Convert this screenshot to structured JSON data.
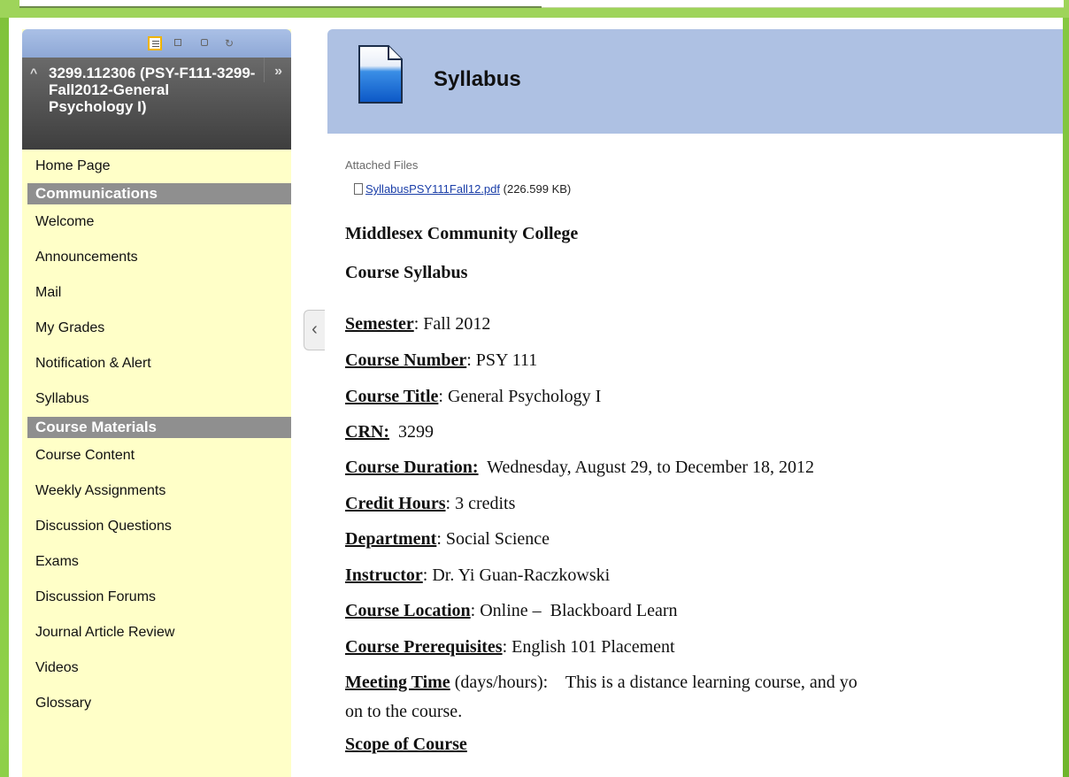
{
  "sidebar": {
    "course_title": "3299.112306 (PSY-F111-3299-Fall2012-General Psychology I)",
    "home": "Home Page",
    "sections": [
      {
        "title": "Communications",
        "items": [
          "Welcome",
          "Announcements",
          "Mail",
          "My Grades",
          "Notification & Alert",
          "Syllabus"
        ]
      },
      {
        "title": "Course Materials",
        "items": [
          "Course Content",
          "Weekly Assignments",
          "Discussion Questions",
          "Exams",
          "Discussion Forums",
          "Journal Article Review",
          "Videos",
          "Glossary"
        ]
      }
    ],
    "tools": [
      "list-view-icon",
      "folder-view-icon",
      "window-view-icon",
      "refresh-icon"
    ]
  },
  "page": {
    "title": "Syllabus",
    "attached_label": "Attached Files",
    "file_name": "SyllabusPSY111Fall12.pdf",
    "file_size": "(226.599 KB)",
    "college": "Middlesex Community College",
    "doc_title": "Course Syllabus",
    "fields": [
      {
        "key": "Semester",
        "sep": ":",
        "value": " Fall 2012"
      },
      {
        "key": "Course Number",
        "sep": ":",
        "value": " PSY 111"
      },
      {
        "key": "Course Title",
        "sep": ":",
        "value": " General Psychology I"
      },
      {
        "key": "CRN:",
        "sep": "",
        "value": "  3299"
      },
      {
        "key": "Course Duration:",
        "sep": "",
        "value": "  Wednesday, August 29, to December 18, 2012"
      },
      {
        "key": "Credit Hours",
        "sep": ":",
        "value": " 3 credits"
      },
      {
        "key": "Department",
        "sep": ":",
        "value": " Social Science"
      },
      {
        "key": "Instructor",
        "sep": ":",
        "value": " Dr. Yi Guan-Raczkowski"
      },
      {
        "key": "Course Location",
        "sep": ":",
        "value": " Online –  Blackboard Learn"
      },
      {
        "key": "Course Prerequisites",
        "sep": ":",
        "value": " English 101 Placement"
      },
      {
        "key": "Meeting Time",
        "sep": "",
        "value": " (days/hours):    This is a distance learning course, and yo"
      }
    ],
    "meeting_cont": "on to the course.",
    "scope": "Scope of Course"
  }
}
